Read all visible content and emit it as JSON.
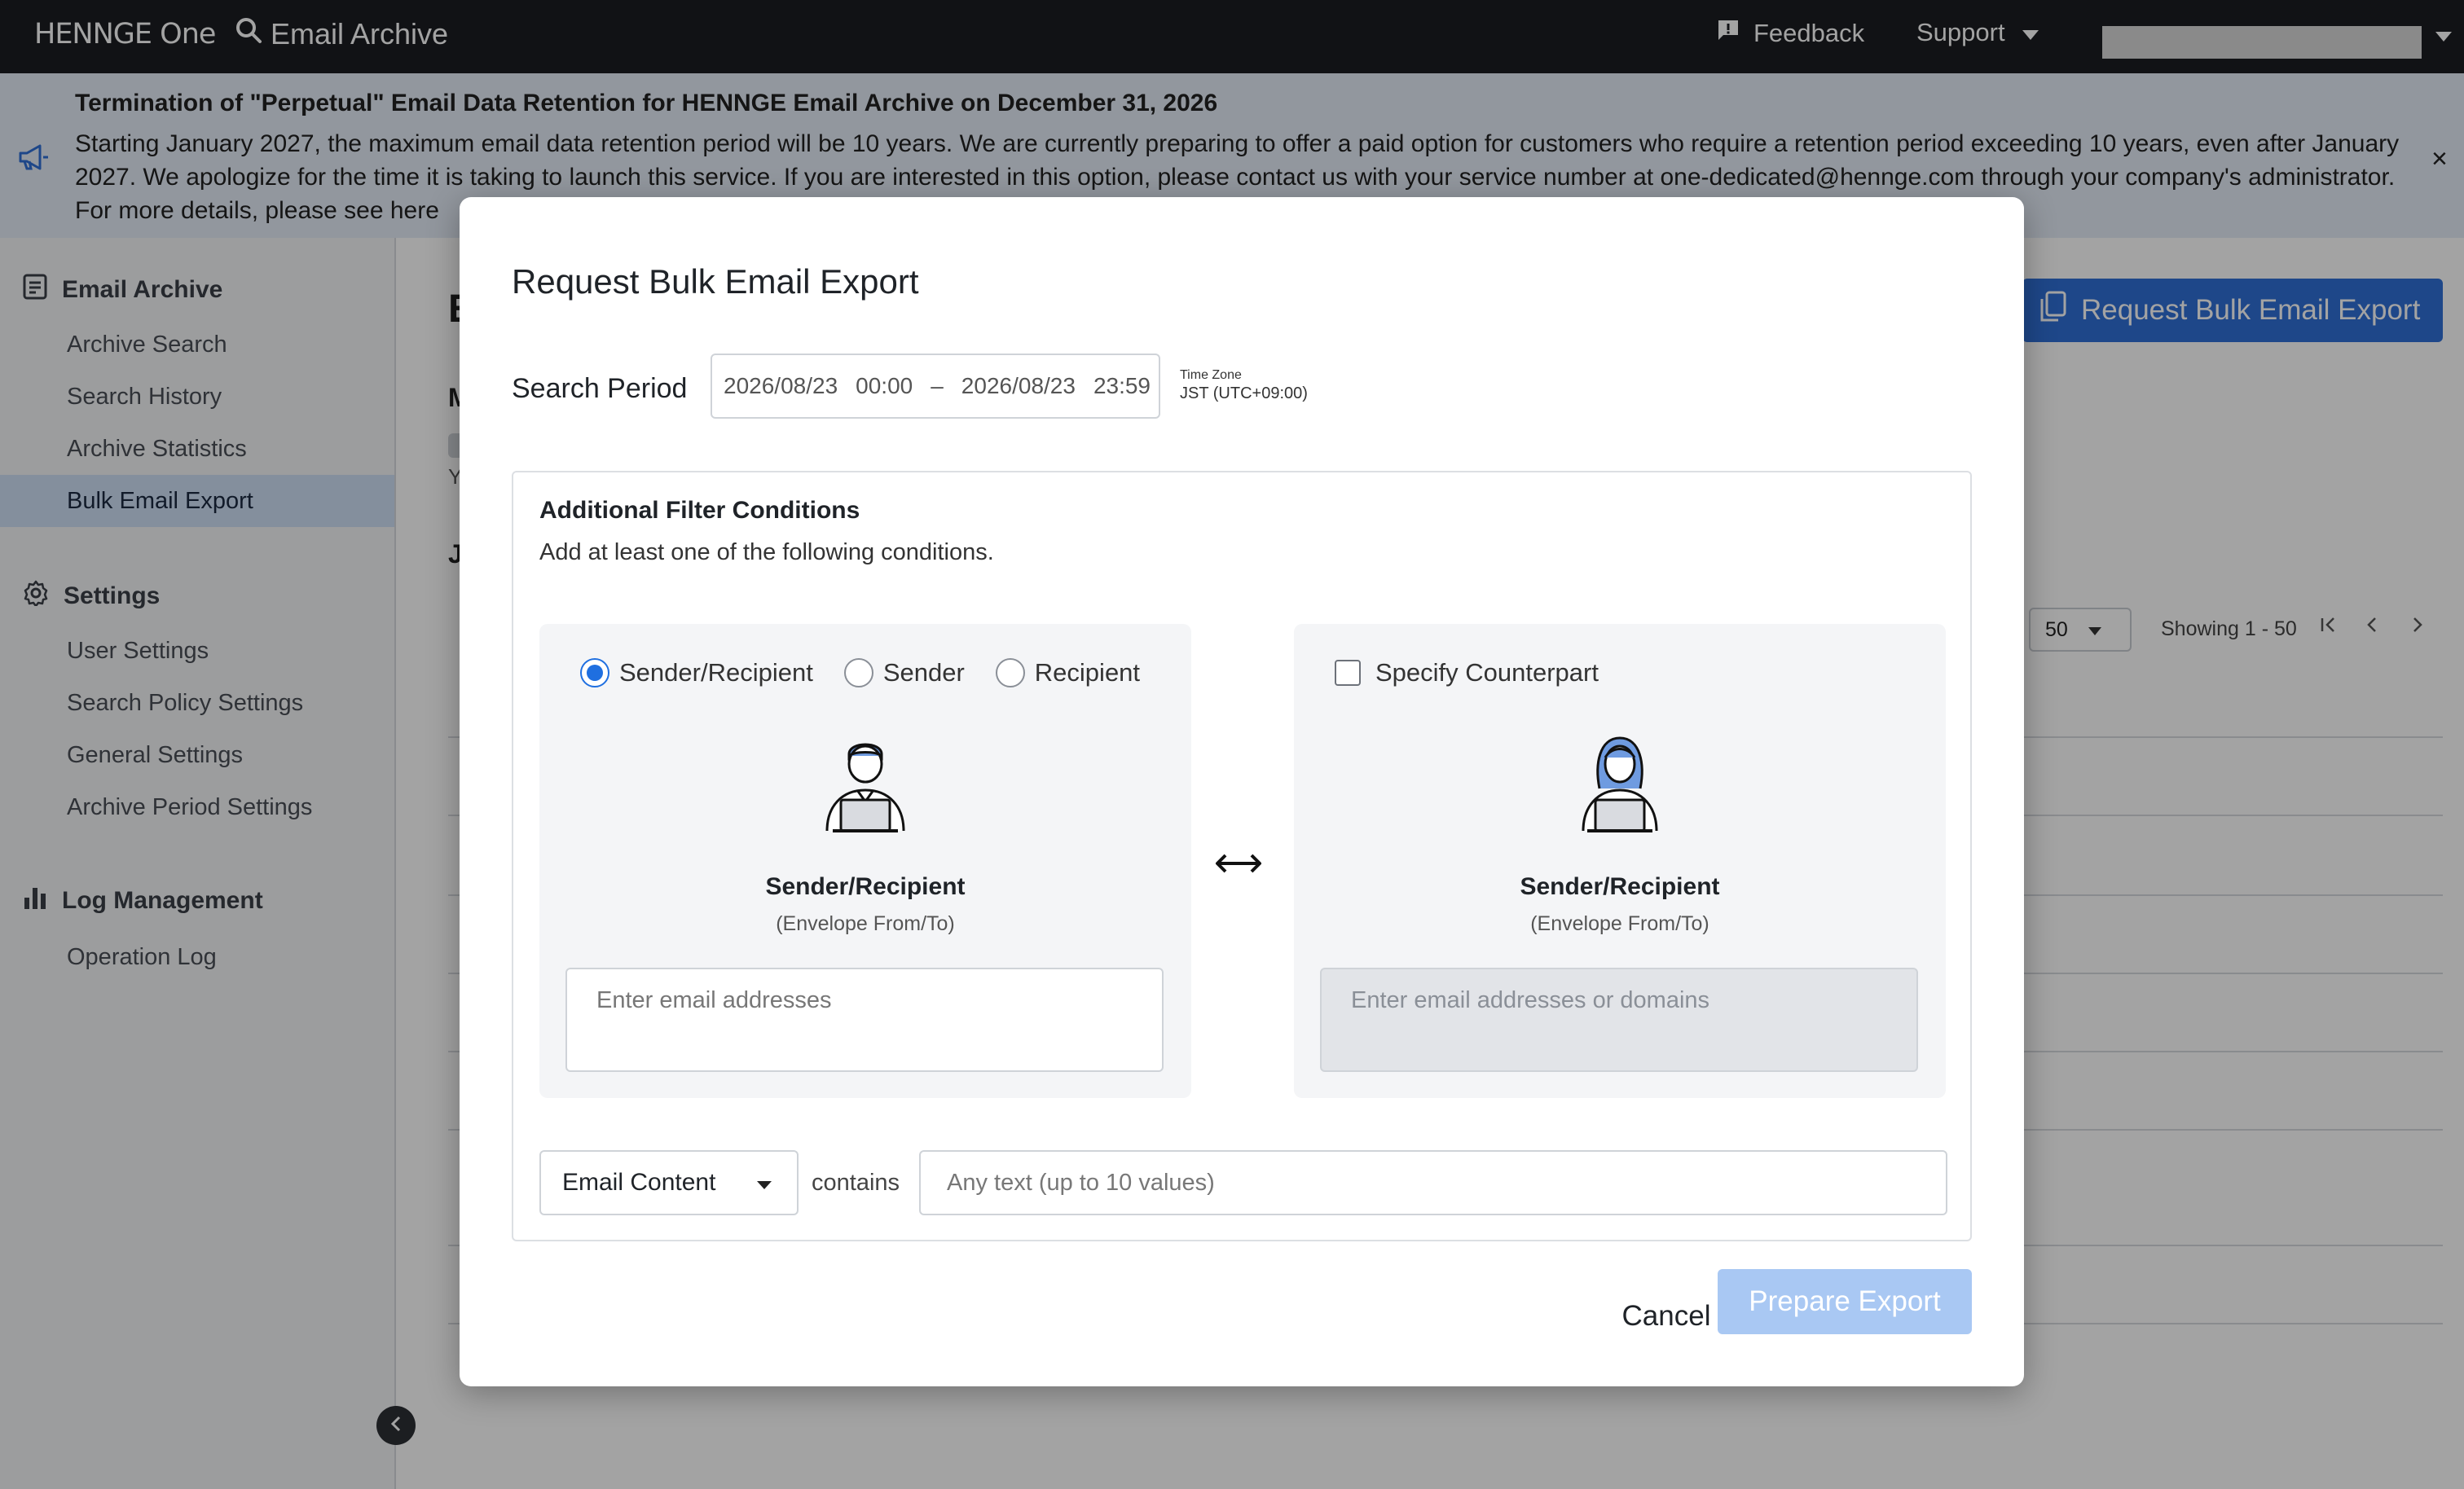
{
  "topbar": {
    "brand": "HENNGE One",
    "app_title": "Email Archive",
    "feedback": "Feedback",
    "support": "Support"
  },
  "announcement": {
    "title": "Termination of \"Perpetual\" Email Data Retention for HENNGE Email Archive on December 31, 2026",
    "body": "Starting January 2027, the maximum email data retention period will be 10 years. We are currently preparing to offer a paid option for customers who require a retention period exceeding 10 years, even after January 2027. We apologize for the time it is taking to launch this service. If you are interested in this option, please contact us with your service number at one-dedicated@hennge.com through your company's administrator. For more details, please see here",
    "close": "×"
  },
  "sidebar": {
    "sections": [
      {
        "title": "Email Archive",
        "items": [
          "Archive Search",
          "Search History",
          "Archive Statistics",
          "Bulk Email Export"
        ]
      },
      {
        "title": "Settings",
        "items": [
          "User Settings",
          "Search Policy Settings",
          "General Settings",
          "Archive Period Settings"
        ]
      },
      {
        "title": "Log Management",
        "items": [
          "Operation Log"
        ]
      }
    ],
    "active_item": "Bulk Email Export"
  },
  "background": {
    "title_initial": "E",
    "section_m": "M",
    "section_y": "Y",
    "section_j": "J",
    "request_button": "Request Bulk Email Export",
    "page_size": "50",
    "showing": "Showing 1 - 50"
  },
  "modal": {
    "title": "Request Bulk Email Export",
    "search_period_label": "Search Period",
    "start_date": "2026/08/23",
    "start_time": "00:00",
    "dash": "–",
    "end_date": "2026/08/23",
    "end_time": "23:59",
    "tz_label": "Time Zone",
    "tz_value": "JST (UTC+09:00)",
    "filter_title": "Additional Filter Conditions",
    "filter_desc": "Add at least one of the following conditions.",
    "left_panel": {
      "options": [
        "Sender/Recipient",
        "Sender",
        "Recipient"
      ],
      "selected": "Sender/Recipient",
      "role_title": "Sender/Recipient",
      "role_sub": "(Envelope From/To)",
      "input_placeholder": "Enter email addresses"
    },
    "right_panel": {
      "checkbox_label": "Specify Counterpart",
      "checked": false,
      "role_title": "Sender/Recipient",
      "role_sub": "(Envelope From/To)",
      "input_placeholder": "Enter email addresses or domains"
    },
    "content_field": "Email Content",
    "contains": "contains",
    "text_placeholder": "Any text (up to 10 values)",
    "cancel": "Cancel",
    "prepare": "Prepare Export"
  },
  "colors": {
    "accent": "#1f6fe0",
    "topbar": "#1b1d21",
    "prepare_disabled": "#a9c8f3"
  }
}
